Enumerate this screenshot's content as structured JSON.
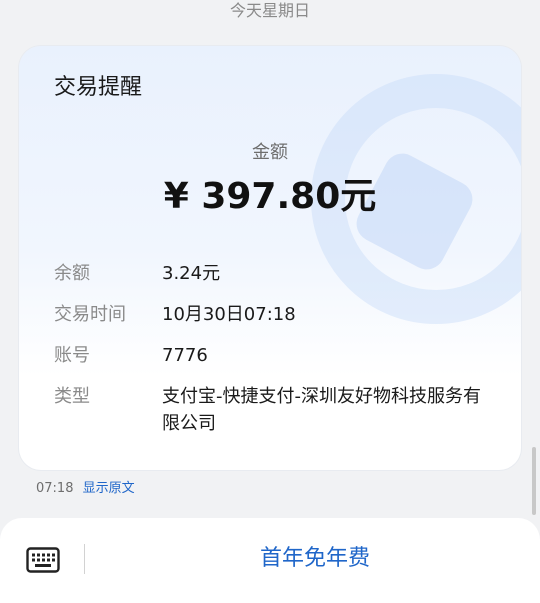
{
  "date_header": "今天星期日",
  "card": {
    "title": "交易提醒",
    "amount_label": "金额",
    "amount_value": "¥ 397.80元",
    "rows": [
      {
        "label": "余额",
        "value": "3.24元"
      },
      {
        "label": "交易时间",
        "value": "10月30日07:18"
      },
      {
        "label": "账号",
        "value": "7776"
      },
      {
        "label": "类型",
        "value": "支付宝-快捷支付-深圳友好物科技服务有限公司"
      }
    ]
  },
  "meta": {
    "time": "07:18",
    "show_original": "显示原文"
  },
  "bottom_bar": {
    "keyboard_icon": "keyboard-icon",
    "action_label": "首年免年费"
  },
  "colors": {
    "accent": "#1f66c9",
    "background": "#f1f2f4"
  }
}
